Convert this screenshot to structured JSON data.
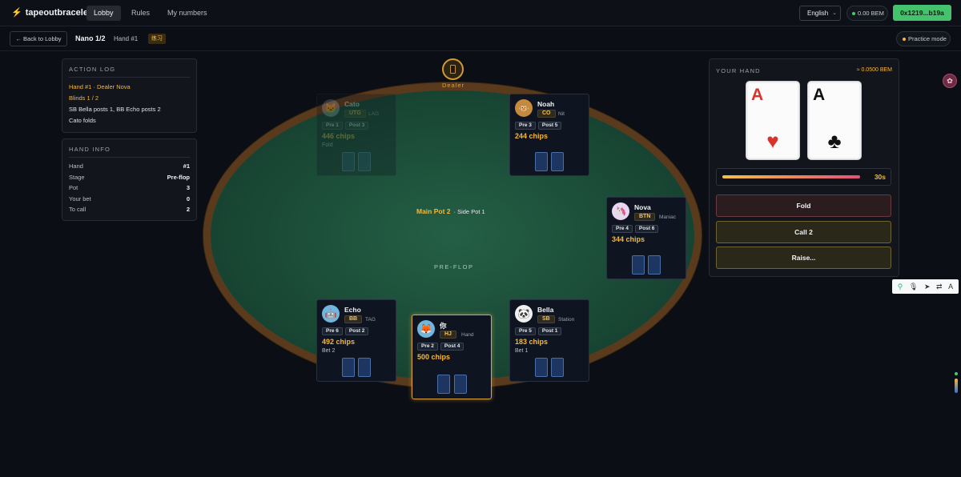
{
  "topbar": {
    "brand": "tapeoutbracelet",
    "nav": [
      "Lobby",
      "Rules",
      "My numbers"
    ],
    "language": "English",
    "balance": "0.00 BEM",
    "wallet": "0x1219...b19a"
  },
  "subbar": {
    "back": "← Back to Lobby",
    "stakes": "Nano 1/2",
    "hand": "Hand #1",
    "tag": "练习",
    "practice": "Practice mode"
  },
  "action_log": {
    "title": "ACTION LOG",
    "lines": [
      "Hand #1 · Dealer Nova",
      "Blinds 1 / 2",
      "SB Bella posts 1, BB Echo posts 2",
      "Cato folds"
    ]
  },
  "hand_info": {
    "title": "HAND INFO",
    "rows": [
      {
        "k": "Hand",
        "v": "#1"
      },
      {
        "k": "Stage",
        "v": "Pre-flop"
      },
      {
        "k": "Pot",
        "v": "3"
      },
      {
        "k": "Your bet",
        "v": "0"
      },
      {
        "k": "To call",
        "v": "2"
      }
    ]
  },
  "table": {
    "dealer_label": "Dealer",
    "main_pot": "Main Pot 2",
    "side_pot": "· Side Pot 1",
    "street": "PRE-FLOP"
  },
  "seats": [
    {
      "name": "Cato",
      "pos": "UTG",
      "style": "LAG",
      "pre": "Pre 1",
      "post": "Post 3",
      "chips": "446 chips",
      "action": "Fold",
      "avatar": "cat-avatar-icon",
      "folded": true
    },
    {
      "name": "Noah",
      "pos": "CO",
      "style": "Nit",
      "pre": "Pre 3",
      "post": "Post 5",
      "chips": "244 chips",
      "action": "",
      "avatar": "monkey-avatar-icon"
    },
    {
      "name": "Nova",
      "pos": "BTN",
      "style": "Maniac",
      "pre": "Pre 4",
      "post": "Post 6",
      "chips": "344 chips",
      "action": "",
      "avatar": "unicorn-avatar-icon"
    },
    {
      "name": "Echo",
      "pos": "BB",
      "style": "TAG",
      "pre": "Pre 6",
      "post": "Post 2",
      "chips": "492 chips",
      "action": "Bet 2",
      "avatar": "robot-avatar-icon"
    },
    {
      "name": "你",
      "pos": "HJ",
      "style": "Hand",
      "pre": "Pre 2",
      "post": "Post 4",
      "chips": "500 chips",
      "action": "",
      "avatar": "fox-avatar-icon",
      "hero": true
    },
    {
      "name": "Bella",
      "pos": "SB",
      "style": "Station",
      "pre": "Pre 5",
      "post": "Post 1",
      "chips": "183 chips",
      "action": "Bet 1",
      "avatar": "panda-avatar-icon"
    }
  ],
  "your_hand": {
    "title": "YOUR HAND",
    "equity": "≈ 0.0500 BEM",
    "cards": [
      {
        "rank": "A",
        "suit": "♥",
        "color": "#d8342c"
      },
      {
        "rank": "A",
        "suit": "♣",
        "color": "#111111"
      }
    ],
    "timer": "30s",
    "timer_fraction": 1.0
  },
  "actions": {
    "fold": "Fold",
    "call": "Call 2",
    "raise": "Raise..."
  },
  "colors": {
    "accent": "#f5b83a",
    "wallet": "#45c26d",
    "felt": "#1a4a36",
    "rail": "#5a3a1c"
  }
}
